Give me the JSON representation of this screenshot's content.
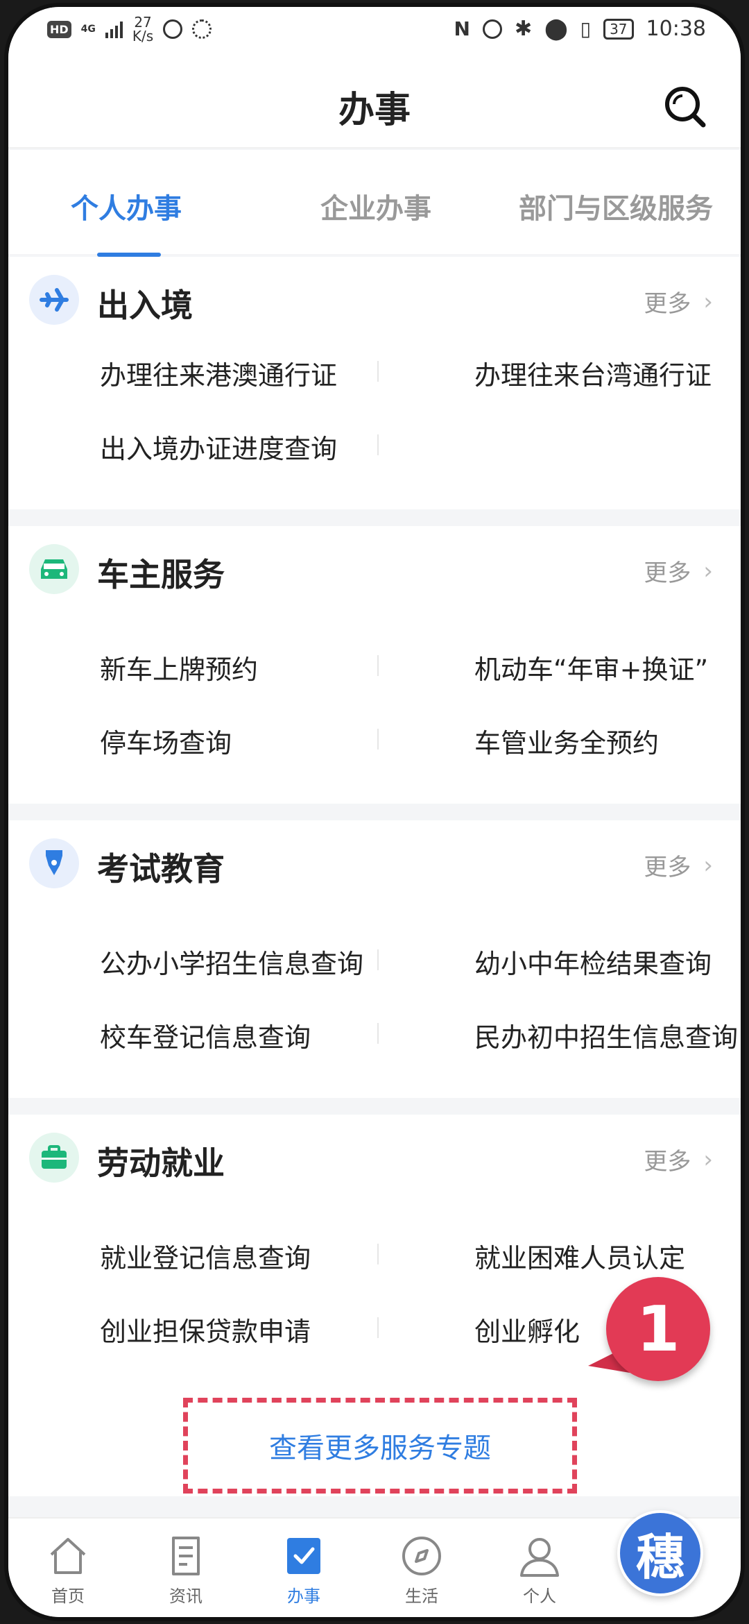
{
  "status_bar": {
    "network": "4G",
    "speed_value": "27",
    "speed_unit": "K/s",
    "battery": "37",
    "time": "10:38"
  },
  "header": {
    "title": "办事"
  },
  "tabs": [
    {
      "label": "个人办事",
      "active": true
    },
    {
      "label": "企业办事",
      "active": false
    },
    {
      "label": "部门与区级服务",
      "active": false
    }
  ],
  "sections": [
    {
      "title": "出入境",
      "icon": "airplane-icon",
      "icon_color": "#2f7de1",
      "icon_bg": "#e8effc",
      "more": "更多",
      "items": [
        "办理往来港澳通行证",
        "办理往来台湾通行证",
        "出入境办证进度查询"
      ]
    },
    {
      "title": "车主服务",
      "icon": "car-icon",
      "icon_color": "#1cb77a",
      "icon_bg": "#e4f6ee",
      "more": "更多",
      "items": [
        "新车上牌预约",
        "机动车“年审+换证”",
        "停车场查询",
        "车管业务全预约"
      ]
    },
    {
      "title": "考试教育",
      "icon": "pen-icon",
      "icon_color": "#2f7de1",
      "icon_bg": "#e8effc",
      "more": "更多",
      "items": [
        "公办小学招生信息查询",
        "幼小中年检结果查询",
        "校车登记信息查询",
        "民办初中招生信息查询"
      ]
    },
    {
      "title": "劳动就业",
      "icon": "briefcase-icon",
      "icon_color": "#1cb77a",
      "icon_bg": "#e4f6ee",
      "more": "更多",
      "items": [
        "就业登记信息查询",
        "就业困难人员认定",
        "创业担保贷款申请",
        "创业孵化"
      ]
    }
  ],
  "see_more": "查看更多服务专题",
  "annotation_badge": "1",
  "bottom_nav": [
    {
      "label": "首页",
      "icon": "home-icon"
    },
    {
      "label": "资讯",
      "icon": "news-icon"
    },
    {
      "label": "办事",
      "icon": "tasks-icon",
      "active": true
    },
    {
      "label": "生活",
      "icon": "compass-icon"
    },
    {
      "label": "个人",
      "icon": "user-icon"
    }
  ],
  "fab": {
    "label": "穗",
    "icon": "assistant-icon"
  },
  "colors": {
    "accent": "#2f7de1",
    "highlight": "#e0435b"
  }
}
